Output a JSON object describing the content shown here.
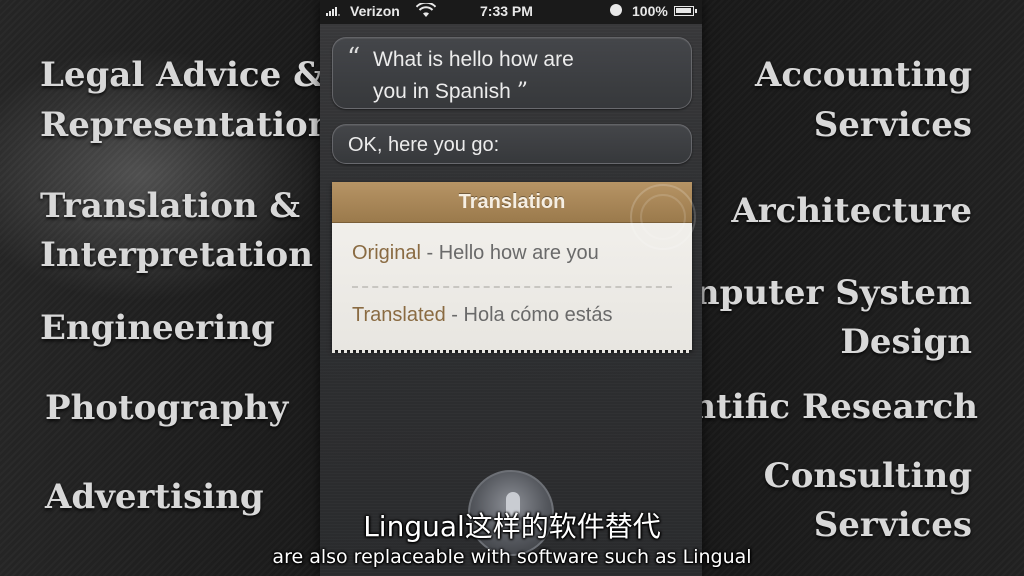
{
  "slide": {
    "left_items": [
      "Legal Advice &",
      "Representation",
      "Translation &",
      "Interpretation",
      "Engineering",
      "Photography",
      "Advertising"
    ],
    "right_items": [
      "Accounting",
      "Services",
      "Architecture",
      "nputer System",
      "Design",
      "ntific Research",
      "Consulting",
      "Services"
    ]
  },
  "status_bar": {
    "carrier": "Verizon",
    "time": "7:33 PM",
    "battery_percent": "100%",
    "signal_level": 4,
    "battery_level": 1.0
  },
  "conversation": {
    "user_query_line1": "What is hello how are",
    "user_query_line2": "you in Spanish",
    "open_quote": "“",
    "close_quote": "”",
    "siri_reply": "OK, here you go:"
  },
  "translation_card": {
    "title": "Translation",
    "original_label": "Original",
    "original_text": " - Hello how are you",
    "translated_label": "Translated",
    "translated_text": " - Hola cómo estás"
  },
  "subtitles": {
    "chinese": "Lingual这样的软件替代",
    "english": "are also replaceable with software such as Lingual"
  },
  "colors": {
    "card_header": "#a8875a",
    "label_brown": "#8a6b42"
  }
}
